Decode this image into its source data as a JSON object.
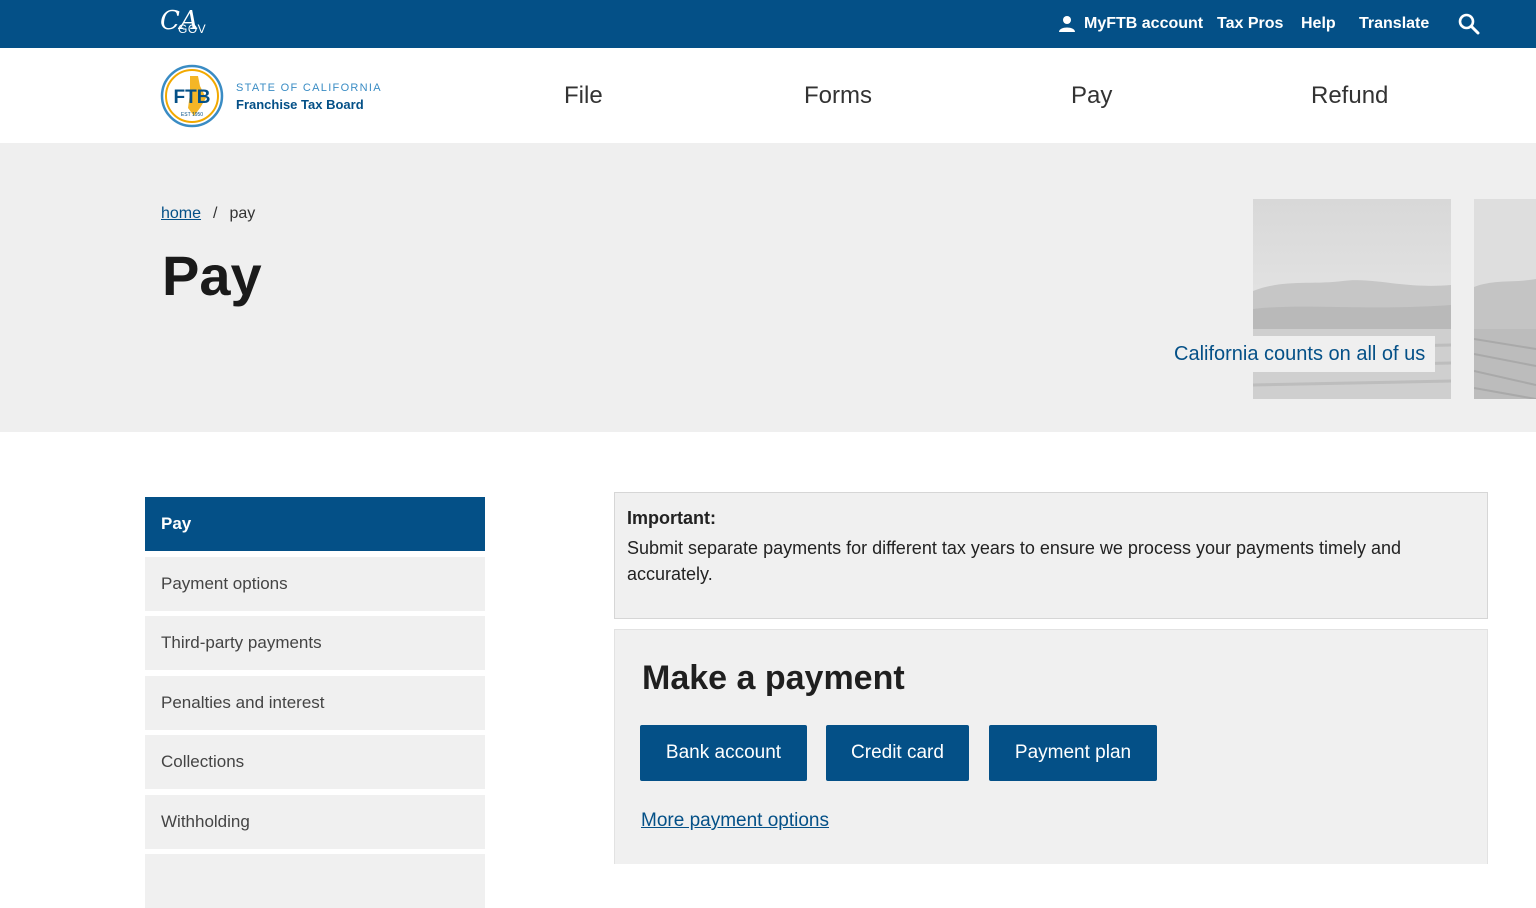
{
  "topbar": {
    "logo_ca": "CA",
    "logo_gov": "GOV",
    "myftb_label": "MyFTB account",
    "taxpros_label": "Tax Pros",
    "help_label": "Help",
    "translate_label": "Translate",
    "icons": {
      "account": "person-icon",
      "search": "search-icon"
    }
  },
  "header": {
    "logo_mark": "FTB",
    "logo_est": "EST 1950",
    "state_label": "STATE OF CALIFORNIA",
    "agency_label": "Franchise Tax Board",
    "nav": {
      "file": "File",
      "forms": "Forms",
      "pay": "Pay",
      "refund": "Refund"
    }
  },
  "hero": {
    "breadcrumb": {
      "home": "home",
      "separator": "/",
      "current": "pay"
    },
    "title": "Pay",
    "tagline": "California counts on all of us"
  },
  "sidebar": {
    "items": [
      {
        "label": "Pay",
        "active": true
      },
      {
        "label": "Payment options"
      },
      {
        "label": "Third-party payments"
      },
      {
        "label": "Penalties and interest"
      },
      {
        "label": "Collections"
      },
      {
        "label": "Withholding"
      },
      {
        "label": ""
      }
    ]
  },
  "notice": {
    "heading": "Important:",
    "body": "Submit separate payments for different tax years to ensure we process your payments timely and accurately."
  },
  "payment": {
    "title": "Make a payment",
    "buttons": {
      "bank": "Bank account",
      "card": "Credit card",
      "plan": "Payment plan"
    },
    "more_link": "More payment options"
  },
  "colors": {
    "brand_blue": "#045087",
    "light_blue": "#3a8cc4",
    "gold": "#f2a900",
    "panel_gray": "#f0f0f0"
  }
}
